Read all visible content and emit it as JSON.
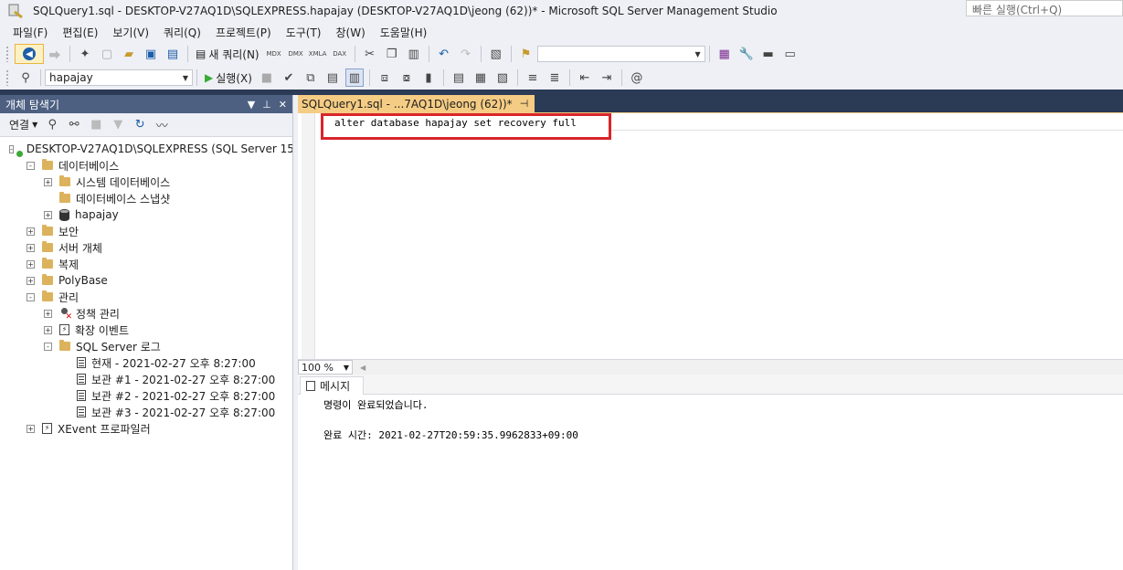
{
  "window": {
    "title": "SQLQuery1.sql - DESKTOP-V27AQ1D\\SQLEXPRESS.hapajay (DESKTOP-V27AQ1D\\jeong (62))* - Microsoft SQL Server Management Studio",
    "quick_launch_placeholder": "빠른 실행(Ctrl+Q)"
  },
  "menu": [
    "파일(F)",
    "편집(E)",
    "보기(V)",
    "쿼리(Q)",
    "프로젝트(P)",
    "도구(T)",
    "창(W)",
    "도움말(H)"
  ],
  "toolbar": {
    "new_query_label": "새 쿼리(N)",
    "execute_label": "실행(X)",
    "database_selected": "hapajay"
  },
  "explorer": {
    "title": "개체 탐색기",
    "connect_label": "연결",
    "tree": [
      {
        "level": 0,
        "exp": "-",
        "icon": "server",
        "label": "DESKTOP-V27AQ1D\\SQLEXPRESS (SQL Server 15"
      },
      {
        "level": 1,
        "exp": "-",
        "icon": "folder",
        "label": "데이터베이스"
      },
      {
        "level": 2,
        "exp": "+",
        "icon": "folder",
        "label": "시스템 데이터베이스"
      },
      {
        "level": 2,
        "exp": "",
        "icon": "folder",
        "label": "데이터베이스 스냅샷"
      },
      {
        "level": 2,
        "exp": "+",
        "icon": "db",
        "label": "hapajay"
      },
      {
        "level": 1,
        "exp": "+",
        "icon": "folder",
        "label": "보안"
      },
      {
        "level": 1,
        "exp": "+",
        "icon": "folder",
        "label": "서버 개체"
      },
      {
        "level": 1,
        "exp": "+",
        "icon": "folder",
        "label": "복제"
      },
      {
        "level": 1,
        "exp": "+",
        "icon": "folder",
        "label": "PolyBase"
      },
      {
        "level": 1,
        "exp": "-",
        "icon": "folder",
        "label": "관리"
      },
      {
        "level": 2,
        "exp": "+",
        "icon": "policy",
        "label": "정책 관리"
      },
      {
        "level": 2,
        "exp": "+",
        "icon": "ext",
        "label": "확장 이벤트"
      },
      {
        "level": 2,
        "exp": "-",
        "icon": "folder",
        "label": "SQL Server 로그"
      },
      {
        "level": 3,
        "exp": "",
        "icon": "doc",
        "label": "현재 - 2021-02-27 오후 8:27:00"
      },
      {
        "level": 3,
        "exp": "",
        "icon": "doc",
        "label": "보관 #1 - 2021-02-27 오후 8:27:00"
      },
      {
        "level": 3,
        "exp": "",
        "icon": "doc",
        "label": "보관 #2 - 2021-02-27 오후 8:27:00"
      },
      {
        "level": 3,
        "exp": "",
        "icon": "doc",
        "label": "보관 #3 - 2021-02-27 오후 8:27:00"
      },
      {
        "level": 1,
        "exp": "+",
        "icon": "ext",
        "label": "XEvent 프로파일러"
      }
    ]
  },
  "editor": {
    "tab_label": "SQLQuery1.sql - ...7AQ1D\\jeong (62))*",
    "code": "alter database hapajay set recovery full",
    "zoom": "100 %"
  },
  "results": {
    "messages_tab": "메시지",
    "line1": "명령이 완료되었습니다.",
    "line2": "완료 시간: 2021-02-27T20:59:35.9962833+09:00"
  }
}
